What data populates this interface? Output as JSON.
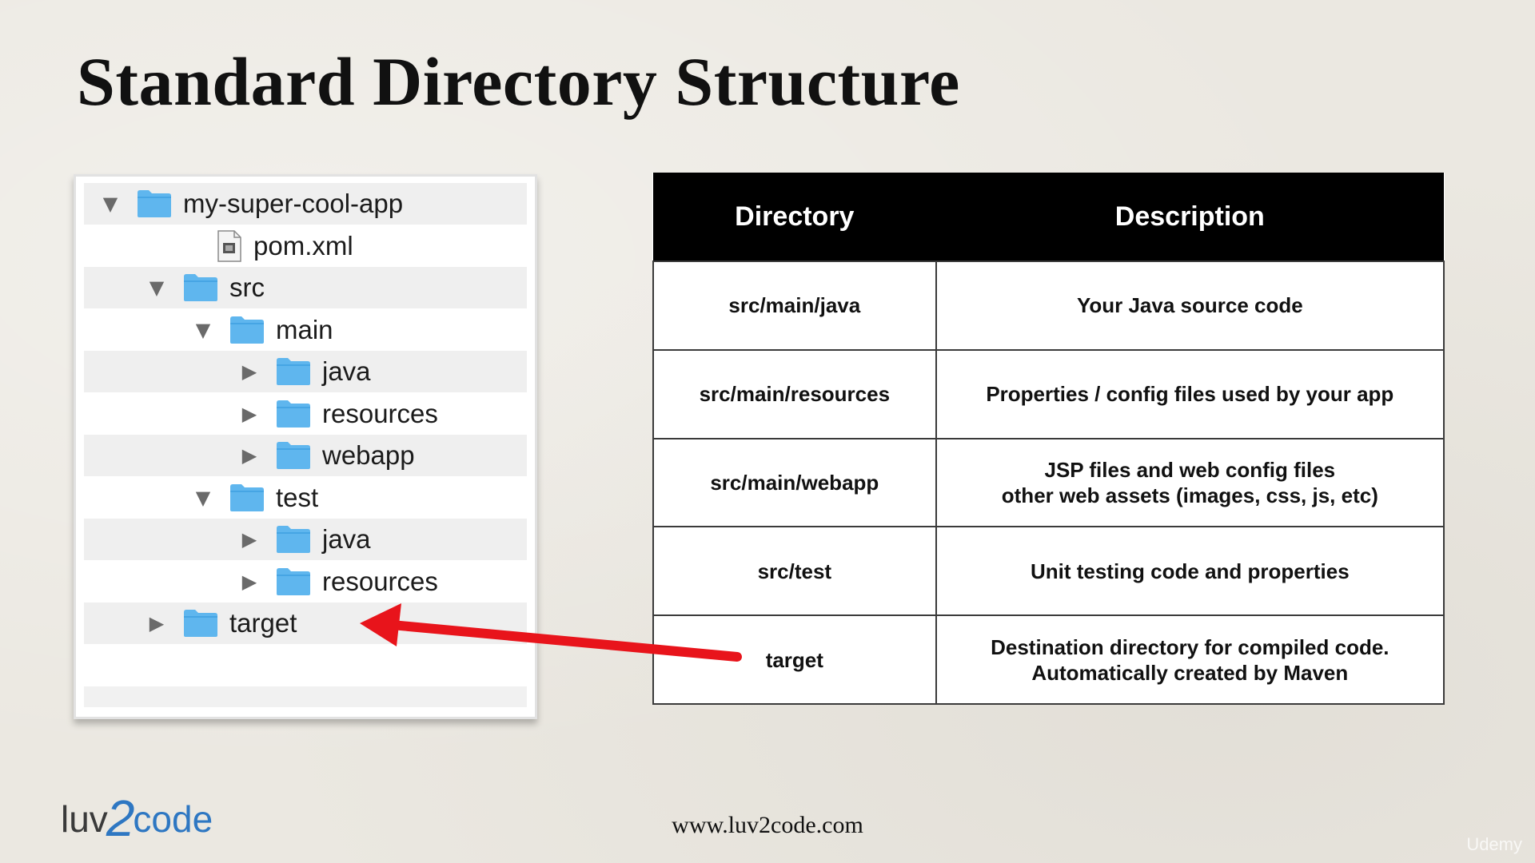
{
  "title": "Standard Directory Structure",
  "tree": {
    "items": [
      {
        "label": "my-super-cool-app",
        "type": "folder",
        "expanded": true,
        "level": 0
      },
      {
        "label": "pom.xml",
        "type": "file",
        "level": 1
      },
      {
        "label": "src",
        "type": "folder",
        "expanded": true,
        "level": 1
      },
      {
        "label": "main",
        "type": "folder",
        "expanded": true,
        "level": 2
      },
      {
        "label": "java",
        "type": "folder",
        "expanded": false,
        "level": 3
      },
      {
        "label": "resources",
        "type": "folder",
        "expanded": false,
        "level": 3
      },
      {
        "label": "webapp",
        "type": "folder",
        "expanded": false,
        "level": 3
      },
      {
        "label": "test",
        "type": "folder",
        "expanded": true,
        "level": 2
      },
      {
        "label": "java",
        "type": "folder",
        "expanded": false,
        "level": 3
      },
      {
        "label": "resources",
        "type": "folder",
        "expanded": false,
        "level": 3
      },
      {
        "label": "target",
        "type": "folder",
        "expanded": false,
        "level": 1
      }
    ]
  },
  "table": {
    "headers": [
      "Directory",
      "Description"
    ],
    "rows": [
      {
        "directory": "src/main/java",
        "description": [
          "Your Java source code"
        ]
      },
      {
        "directory": "src/main/resources",
        "description": [
          "Properties / config files used by your app"
        ]
      },
      {
        "directory": "src/main/webapp",
        "description": [
          "JSP files and web config files",
          "other web assets (images, css, js, etc)"
        ]
      },
      {
        "directory": "src/test",
        "description": [
          "Unit testing code and properties"
        ]
      },
      {
        "directory": "target",
        "description": [
          "Destination directory for compiled code.",
          "Automatically created by Maven"
        ]
      }
    ]
  },
  "logo": {
    "part1": "luv",
    "part2": "2",
    "part3": "code"
  },
  "footer_url": "www.luv2code.com",
  "watermark": "Udemy",
  "colors": {
    "folder": "#5fb6ee",
    "arrow": "#e8141b",
    "header_bg": "#000000",
    "logo_blue": "#2e77c2"
  }
}
